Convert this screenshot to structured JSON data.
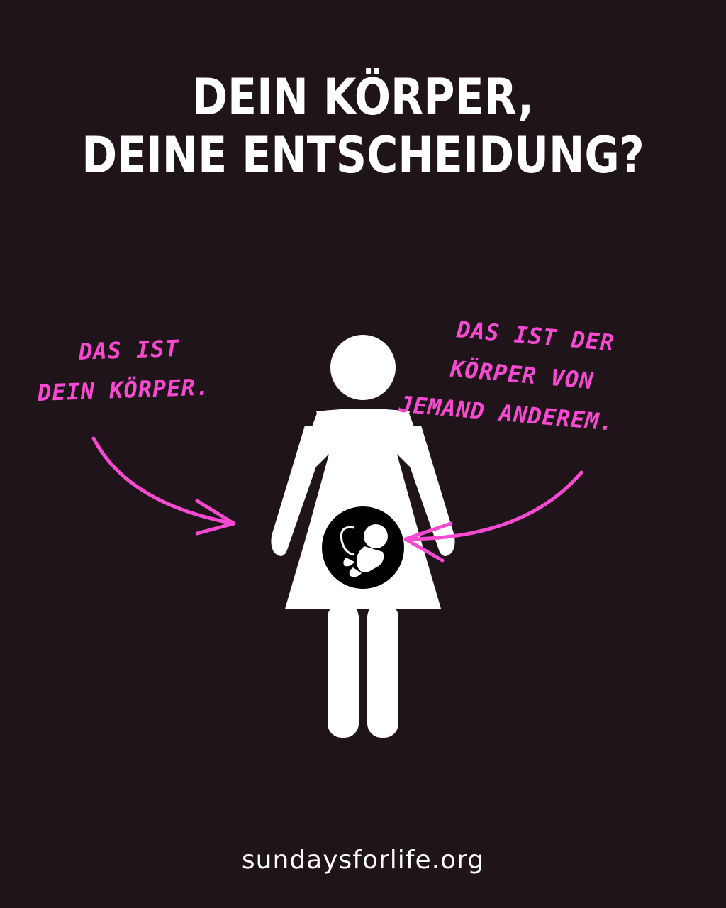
{
  "headline": {
    "line1": "DEIN KÖRPER,",
    "line2": "DEINE ENTSCHEIDUNG?"
  },
  "annotations": {
    "left": {
      "line1": "Das ist",
      "line2": "dein Körper."
    },
    "right": {
      "line1": "Das ist der",
      "line2": "Körper von",
      "line3": "jemand anderem."
    }
  },
  "footer": {
    "url": "sundaysforlife.org"
  },
  "colors": {
    "background": "#1f141a",
    "text": "#ffffff",
    "accent": "#f74ad0"
  },
  "icons": {
    "figure": "woman-figure-icon",
    "fetus": "fetus-icon"
  }
}
